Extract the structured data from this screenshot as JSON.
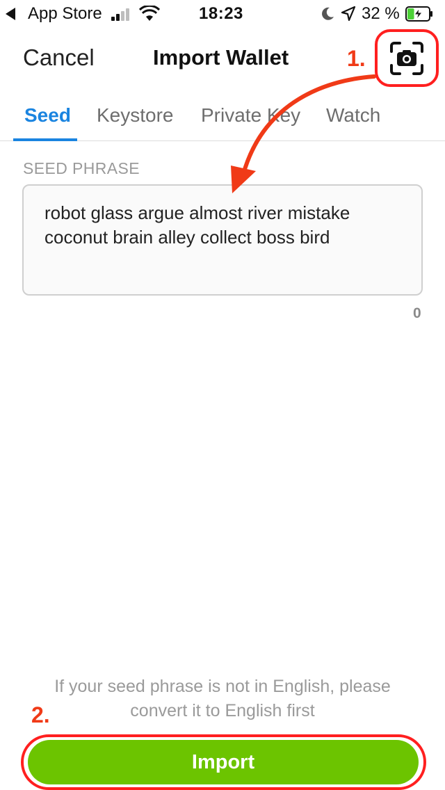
{
  "status_bar": {
    "carrier": "App Store",
    "time": "18:23",
    "battery_percent": "32 %",
    "battery_level": 0.32,
    "icons": [
      "back-arrow-icon",
      "signal-icon",
      "wifi-icon",
      "moon-icon",
      "location-icon",
      "battery-charging-icon"
    ]
  },
  "nav": {
    "cancel": "Cancel",
    "title": "Import Wallet",
    "scan_icon": "camera-scan-icon"
  },
  "tabs": [
    {
      "label": "Seed",
      "active": true
    },
    {
      "label": "Keystore",
      "active": false
    },
    {
      "label": "Private Key",
      "active": false
    },
    {
      "label": "Watch",
      "active": false
    }
  ],
  "seed": {
    "label": "SEED PHRASE",
    "value": "robot glass argue almost river mistake coconut brain alley collect boss bird",
    "word_count": "0"
  },
  "hint": "If your seed phrase is not in English, please convert it to English first",
  "import_button": "Import",
  "annotations": {
    "step1": "1.",
    "step2": "2."
  },
  "colors": {
    "accent": "#1a84e0",
    "import_green": "#6cc400",
    "annotation_red": "#f03a17"
  }
}
